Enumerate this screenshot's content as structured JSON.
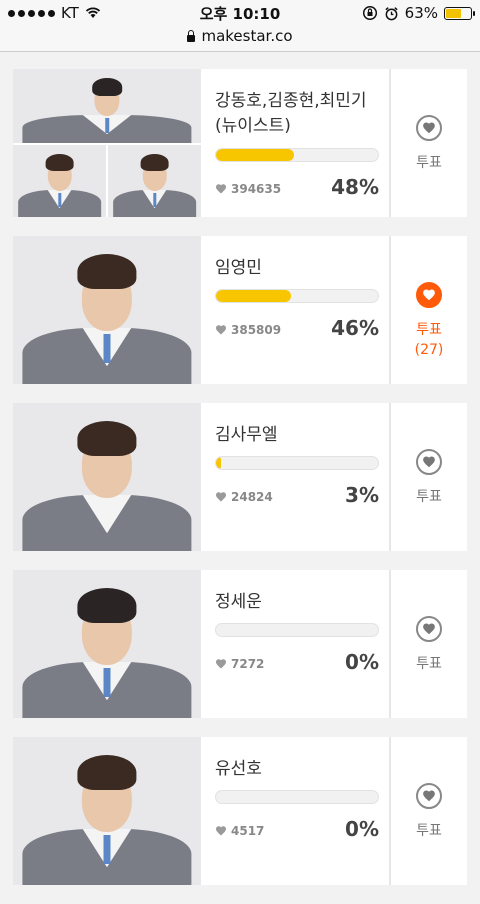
{
  "status": {
    "carrier": "KT",
    "time": "오후 10:10",
    "battery": "63%",
    "battery_fraction": 0.63
  },
  "browser": {
    "url": "makestar.co"
  },
  "vote_label": "투표",
  "candidates": [
    {
      "name": "강동호,김종현,최민기(뉴이스트)",
      "votes": "394635",
      "percent": "48%",
      "progress": 0.48,
      "voted": false,
      "vote_count": ""
    },
    {
      "name": "임영민",
      "votes": "385809",
      "percent": "46%",
      "progress": 0.46,
      "voted": true,
      "vote_count": "(27)"
    },
    {
      "name": "김사무엘",
      "votes": "24824",
      "percent": "3%",
      "progress": 0.03,
      "voted": false,
      "vote_count": ""
    },
    {
      "name": "정세운",
      "votes": "7272",
      "percent": "0%",
      "progress": 0.0,
      "voted": false,
      "vote_count": ""
    },
    {
      "name": "유선호",
      "votes": "4517",
      "percent": "0%",
      "progress": 0.0,
      "voted": false,
      "vote_count": ""
    }
  ],
  "colors": {
    "accent": "#ff5a0a",
    "progress": "#f7c600"
  }
}
